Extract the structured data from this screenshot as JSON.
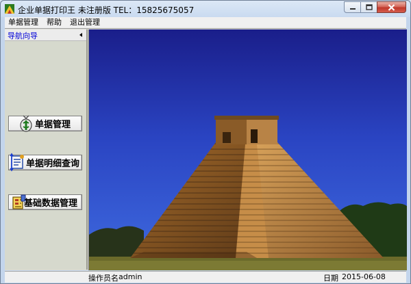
{
  "window": {
    "title": "企业单据打印王 未注册版  TEL：15825675057"
  },
  "menu": {
    "items": [
      "单据管理",
      "帮助",
      "退出管理"
    ]
  },
  "nav": {
    "header": "导航向导",
    "buttons": [
      {
        "label": "单据管理",
        "icon": "money-bag-icon"
      },
      {
        "label": "单据明细查询",
        "icon": "document-list-icon"
      },
      {
        "label": "基础数据管理",
        "icon": "data-form-icon"
      }
    ]
  },
  "main": {
    "picture": "pyramid-photo"
  },
  "status": {
    "operator_label": "操作员名",
    "operator_value": "admin",
    "date_label": "日期",
    "date_value": "2015-06-08"
  }
}
